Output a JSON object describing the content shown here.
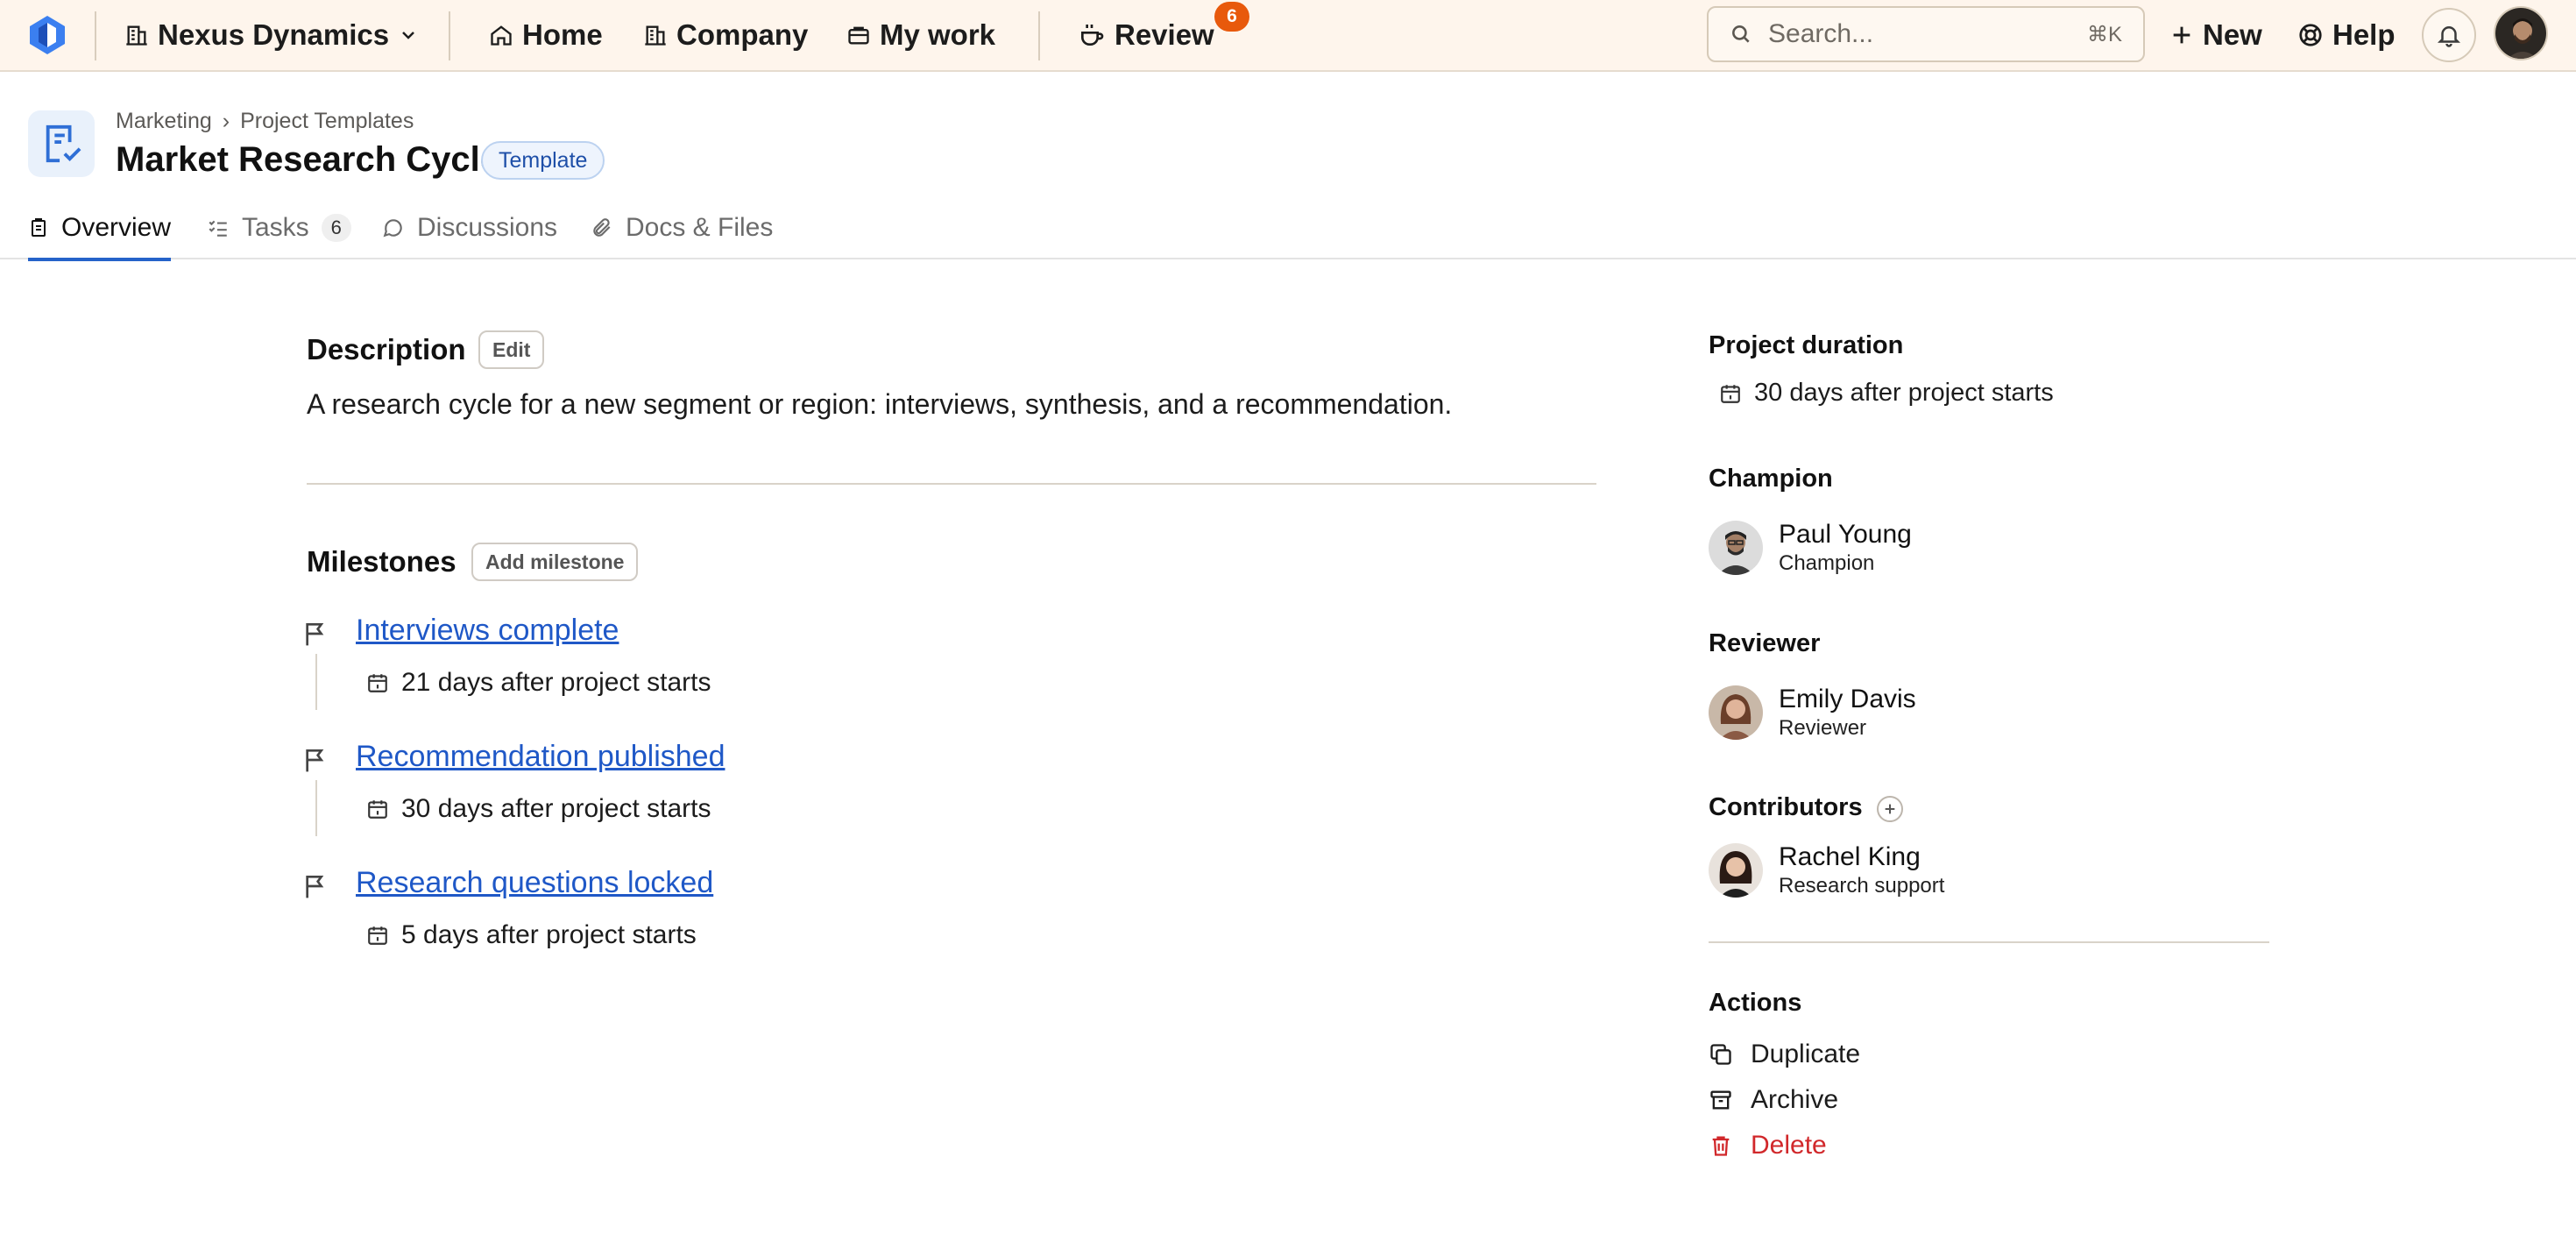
{
  "topbar": {
    "org_name": "Nexus Dynamics",
    "nav": {
      "home": "Home",
      "company": "Company",
      "my_work": "My work",
      "review": "Review"
    },
    "review_count": "6",
    "search_placeholder": "Search...",
    "search_shortcut": "⌘K",
    "new_label": "New",
    "help_label": "Help",
    "icons": [
      "logo-icon",
      "building-icon",
      "chevron-down-icon",
      "home-icon",
      "company-icon",
      "briefcase-icon",
      "coffee-icon",
      "search-icon",
      "plus-icon",
      "lifebuoy-icon",
      "bell-icon"
    ]
  },
  "header": {
    "breadcrumb": [
      "Marketing",
      "Project Templates"
    ],
    "title": "Market Research Cycle",
    "badge": "Template"
  },
  "tabs": [
    {
      "label": "Overview",
      "active": true
    },
    {
      "label": "Tasks",
      "count": "6"
    },
    {
      "label": "Discussions"
    },
    {
      "label": "Docs & Files"
    }
  ],
  "description": {
    "heading": "Description",
    "edit_label": "Edit",
    "text": "A research cycle for a new segment or region: interviews, synthesis, and a recommendation."
  },
  "milestones": {
    "heading": "Milestones",
    "add_label": "Add milestone",
    "items": [
      {
        "title": "Interviews complete",
        "due": "21 days after project starts"
      },
      {
        "title": "Recommendation published",
        "due": "30 days after project starts"
      },
      {
        "title": "Research questions locked",
        "due": "5 days after project starts"
      }
    ]
  },
  "sidebar": {
    "duration": {
      "heading": "Project duration",
      "value": "30 days after project starts"
    },
    "champion": {
      "heading": "Champion",
      "name": "Paul Young",
      "role": "Champion"
    },
    "reviewer": {
      "heading": "Reviewer",
      "name": "Emily Davis",
      "role": "Reviewer"
    },
    "contributors": {
      "heading": "Contributors",
      "people": [
        {
          "name": "Rachel King",
          "role": "Research support"
        }
      ]
    },
    "actions": {
      "heading": "Actions",
      "duplicate": "Duplicate",
      "archive": "Archive",
      "delete": "Delete"
    }
  },
  "colors": {
    "topbar_bg": "#fef5ec",
    "accent": "#2563c9",
    "link": "#1f58c7",
    "badge": "#e8590c",
    "danger": "#d1282b"
  }
}
